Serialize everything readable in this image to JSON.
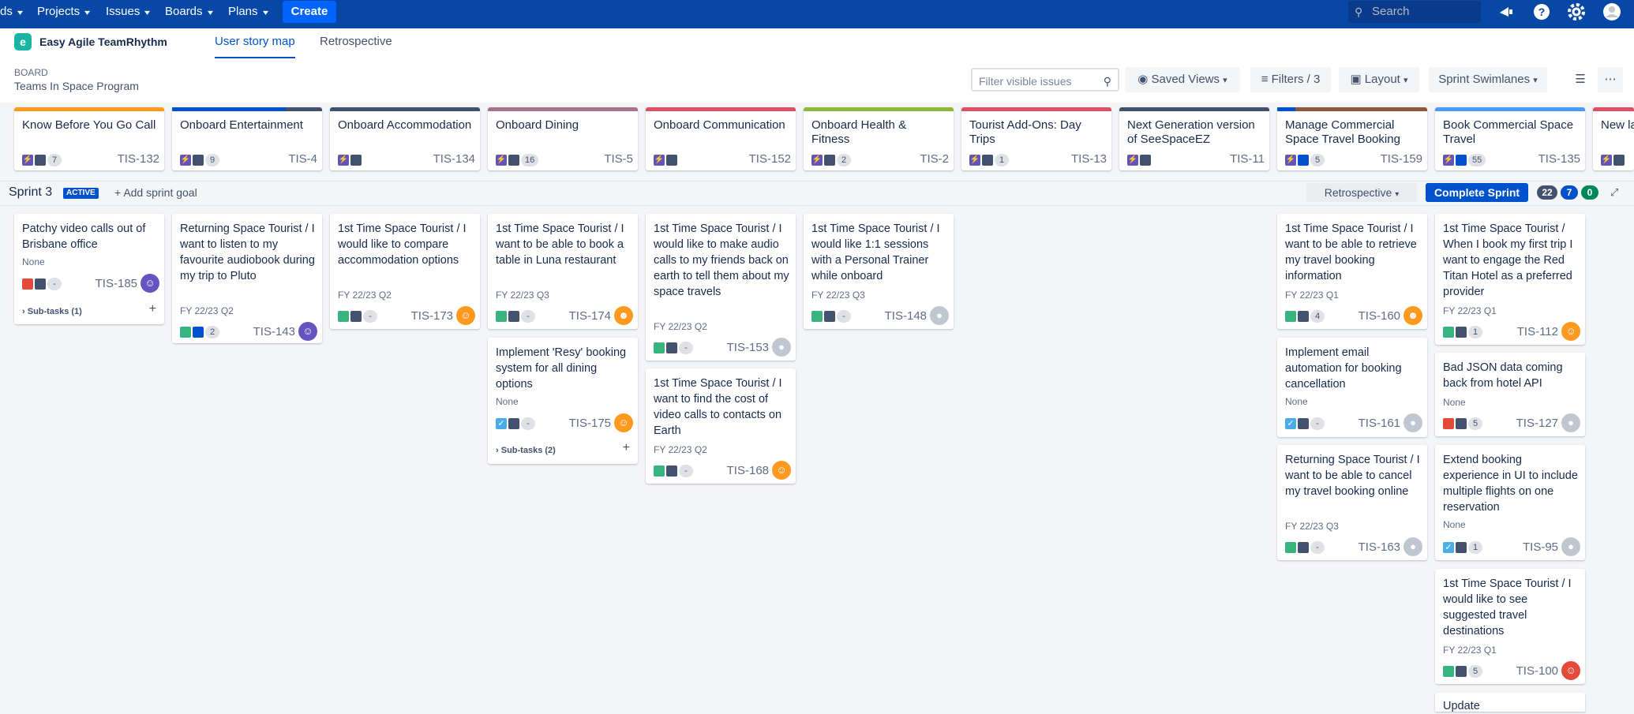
{
  "topnav": {
    "items": [
      "ds",
      "Projects",
      "Issues",
      "Boards",
      "Plans"
    ],
    "create_label": "Create",
    "search_placeholder": "Search"
  },
  "subnav": {
    "app_name": "Easy Agile TeamRhythm",
    "tabs": [
      "User story map",
      "Retrospective"
    ]
  },
  "board": {
    "label": "BOARD",
    "name": "Teams In Space Program",
    "filter_placeholder": "Filter visible issues",
    "saved_views": "Saved Views",
    "filters": "Filters / 3",
    "layout": "Layout",
    "swimlanes": "Sprint Swimlanes"
  },
  "epics": [
    {
      "title": "Know Before You Go Call",
      "key": "TIS-132",
      "count": "7",
      "color": "#ff991f",
      "progress": 0
    },
    {
      "title": "Onboard Entertainment",
      "key": "TIS-4",
      "count": "9",
      "color": "#42526e",
      "progress": 0.76
    },
    {
      "title": "Onboard Accommodation",
      "key": "TIS-134",
      "count": "",
      "color": "#42526e",
      "progress": 0
    },
    {
      "title": "Onboard Dining",
      "key": "TIS-5",
      "count": "16",
      "color": "#a5728d",
      "progress": 0
    },
    {
      "title": "Onboard Communication",
      "key": "TIS-152",
      "count": "",
      "color": "#de4e64",
      "progress": 0
    },
    {
      "title": "Onboard Health & Fitness",
      "key": "TIS-2",
      "count": "2",
      "color": "#8fb83b",
      "progress": 0
    },
    {
      "title": "Tourist Add-Ons: Day Trips",
      "key": "TIS-13",
      "count": "1",
      "color": "#de4e64",
      "progress": 0
    },
    {
      "title": "Next Generation version of SeeSpaceEZ",
      "key": "TIS-11",
      "count": "",
      "color": "#42526e",
      "progress": 0
    },
    {
      "title": "Manage Commercial Space Travel Booking",
      "key": "TIS-159",
      "count": "5",
      "color": "#8b5a3c",
      "progress": 0.12
    },
    {
      "title": "Book Commercial Space Travel",
      "key": "TIS-135",
      "count": "55",
      "color": "#4c9aff",
      "progress": 0
    },
    {
      "title": "New la",
      "key": "",
      "count": "",
      "color": "#de4e64",
      "progress": 0
    }
  ],
  "sprint": {
    "name": "Sprint 3",
    "status": "ACTIVE",
    "add_goal": "Add sprint goal",
    "retro": "Retrospective",
    "complete": "Complete Sprint",
    "counts": [
      "22",
      "7",
      "0"
    ]
  },
  "cards": {
    "c185": {
      "title": "Patchy video calls out of Brisbane office",
      "meta": "None",
      "pill": "-",
      "key": "TIS-185",
      "subtasks": "Sub-tasks (1)"
    },
    "c143": {
      "title": "Returning Space Tourist / I want to listen to my favourite audiobook during my trip to Pluto",
      "meta": "FY 22/23 Q2",
      "pill": "2",
      "key": "TIS-143"
    },
    "c173": {
      "title": "1st Time Space Tourist / I would like to compare accommodation options",
      "meta": "FY 22/23 Q2",
      "pill": "-",
      "key": "TIS-173"
    },
    "c174": {
      "title": "1st Time Space Tourist / I want to be able to book a table in Luna restaurant",
      "meta": "FY 22/23 Q3",
      "pill": "-",
      "key": "TIS-174"
    },
    "c175": {
      "title": "Implement 'Resy' booking system for all dining options",
      "meta": "None",
      "pill": "-",
      "key": "TIS-175",
      "subtasks": "Sub-tasks (2)"
    },
    "c153": {
      "title": "1st Time Space Tourist / I would like to make audio calls to my friends back on earth to tell them about my space travels",
      "meta": "FY 22/23 Q2",
      "pill": "-",
      "key": "TIS-153"
    },
    "c168": {
      "title": "1st Time Space Tourist / I want to find the cost of video calls to contacts on Earth",
      "meta": "FY 22/23 Q2",
      "pill": "-",
      "key": "TIS-168"
    },
    "c148": {
      "title": "1st Time Space Tourist / I would like 1:1 sessions with a Personal Trainer while onboard",
      "meta": "FY 22/23 Q3",
      "pill": "-",
      "key": "TIS-148"
    },
    "c160": {
      "title": "1st Time Space Tourist / I want to be able to retrieve my travel booking information",
      "meta": "FY 22/23 Q1",
      "pill": "4",
      "key": "TIS-160"
    },
    "c161": {
      "title": "Implement email automation for booking cancellation",
      "meta": "None",
      "pill": "-",
      "key": "TIS-161"
    },
    "c163": {
      "title": "Returning Space Tourist / I want to be able to cancel my travel booking online",
      "meta": "FY 22/23 Q3",
      "pill": "-",
      "key": "TIS-163"
    },
    "c112": {
      "title": "1st Time Space Tourist / When I book my first trip I want to engage the Red Titan Hotel as a preferred provider",
      "meta": "FY 22/23 Q1",
      "pill": "1",
      "key": "TIS-112"
    },
    "c127": {
      "title": "Bad JSON data coming back from hotel API",
      "meta": "None",
      "pill": "5",
      "key": "TIS-127"
    },
    "c95": {
      "title": "Extend booking experience in UI to include multiple flights on one reservation",
      "meta": "None",
      "pill": "1",
      "key": "TIS-95"
    },
    "c100": {
      "title": "1st Time Space Tourist / I would like to see suggested travel destinations",
      "meta": "FY 22/23 Q1",
      "pill": "5",
      "key": "TIS-100"
    },
    "cupdate": {
      "title": "Update"
    }
  }
}
